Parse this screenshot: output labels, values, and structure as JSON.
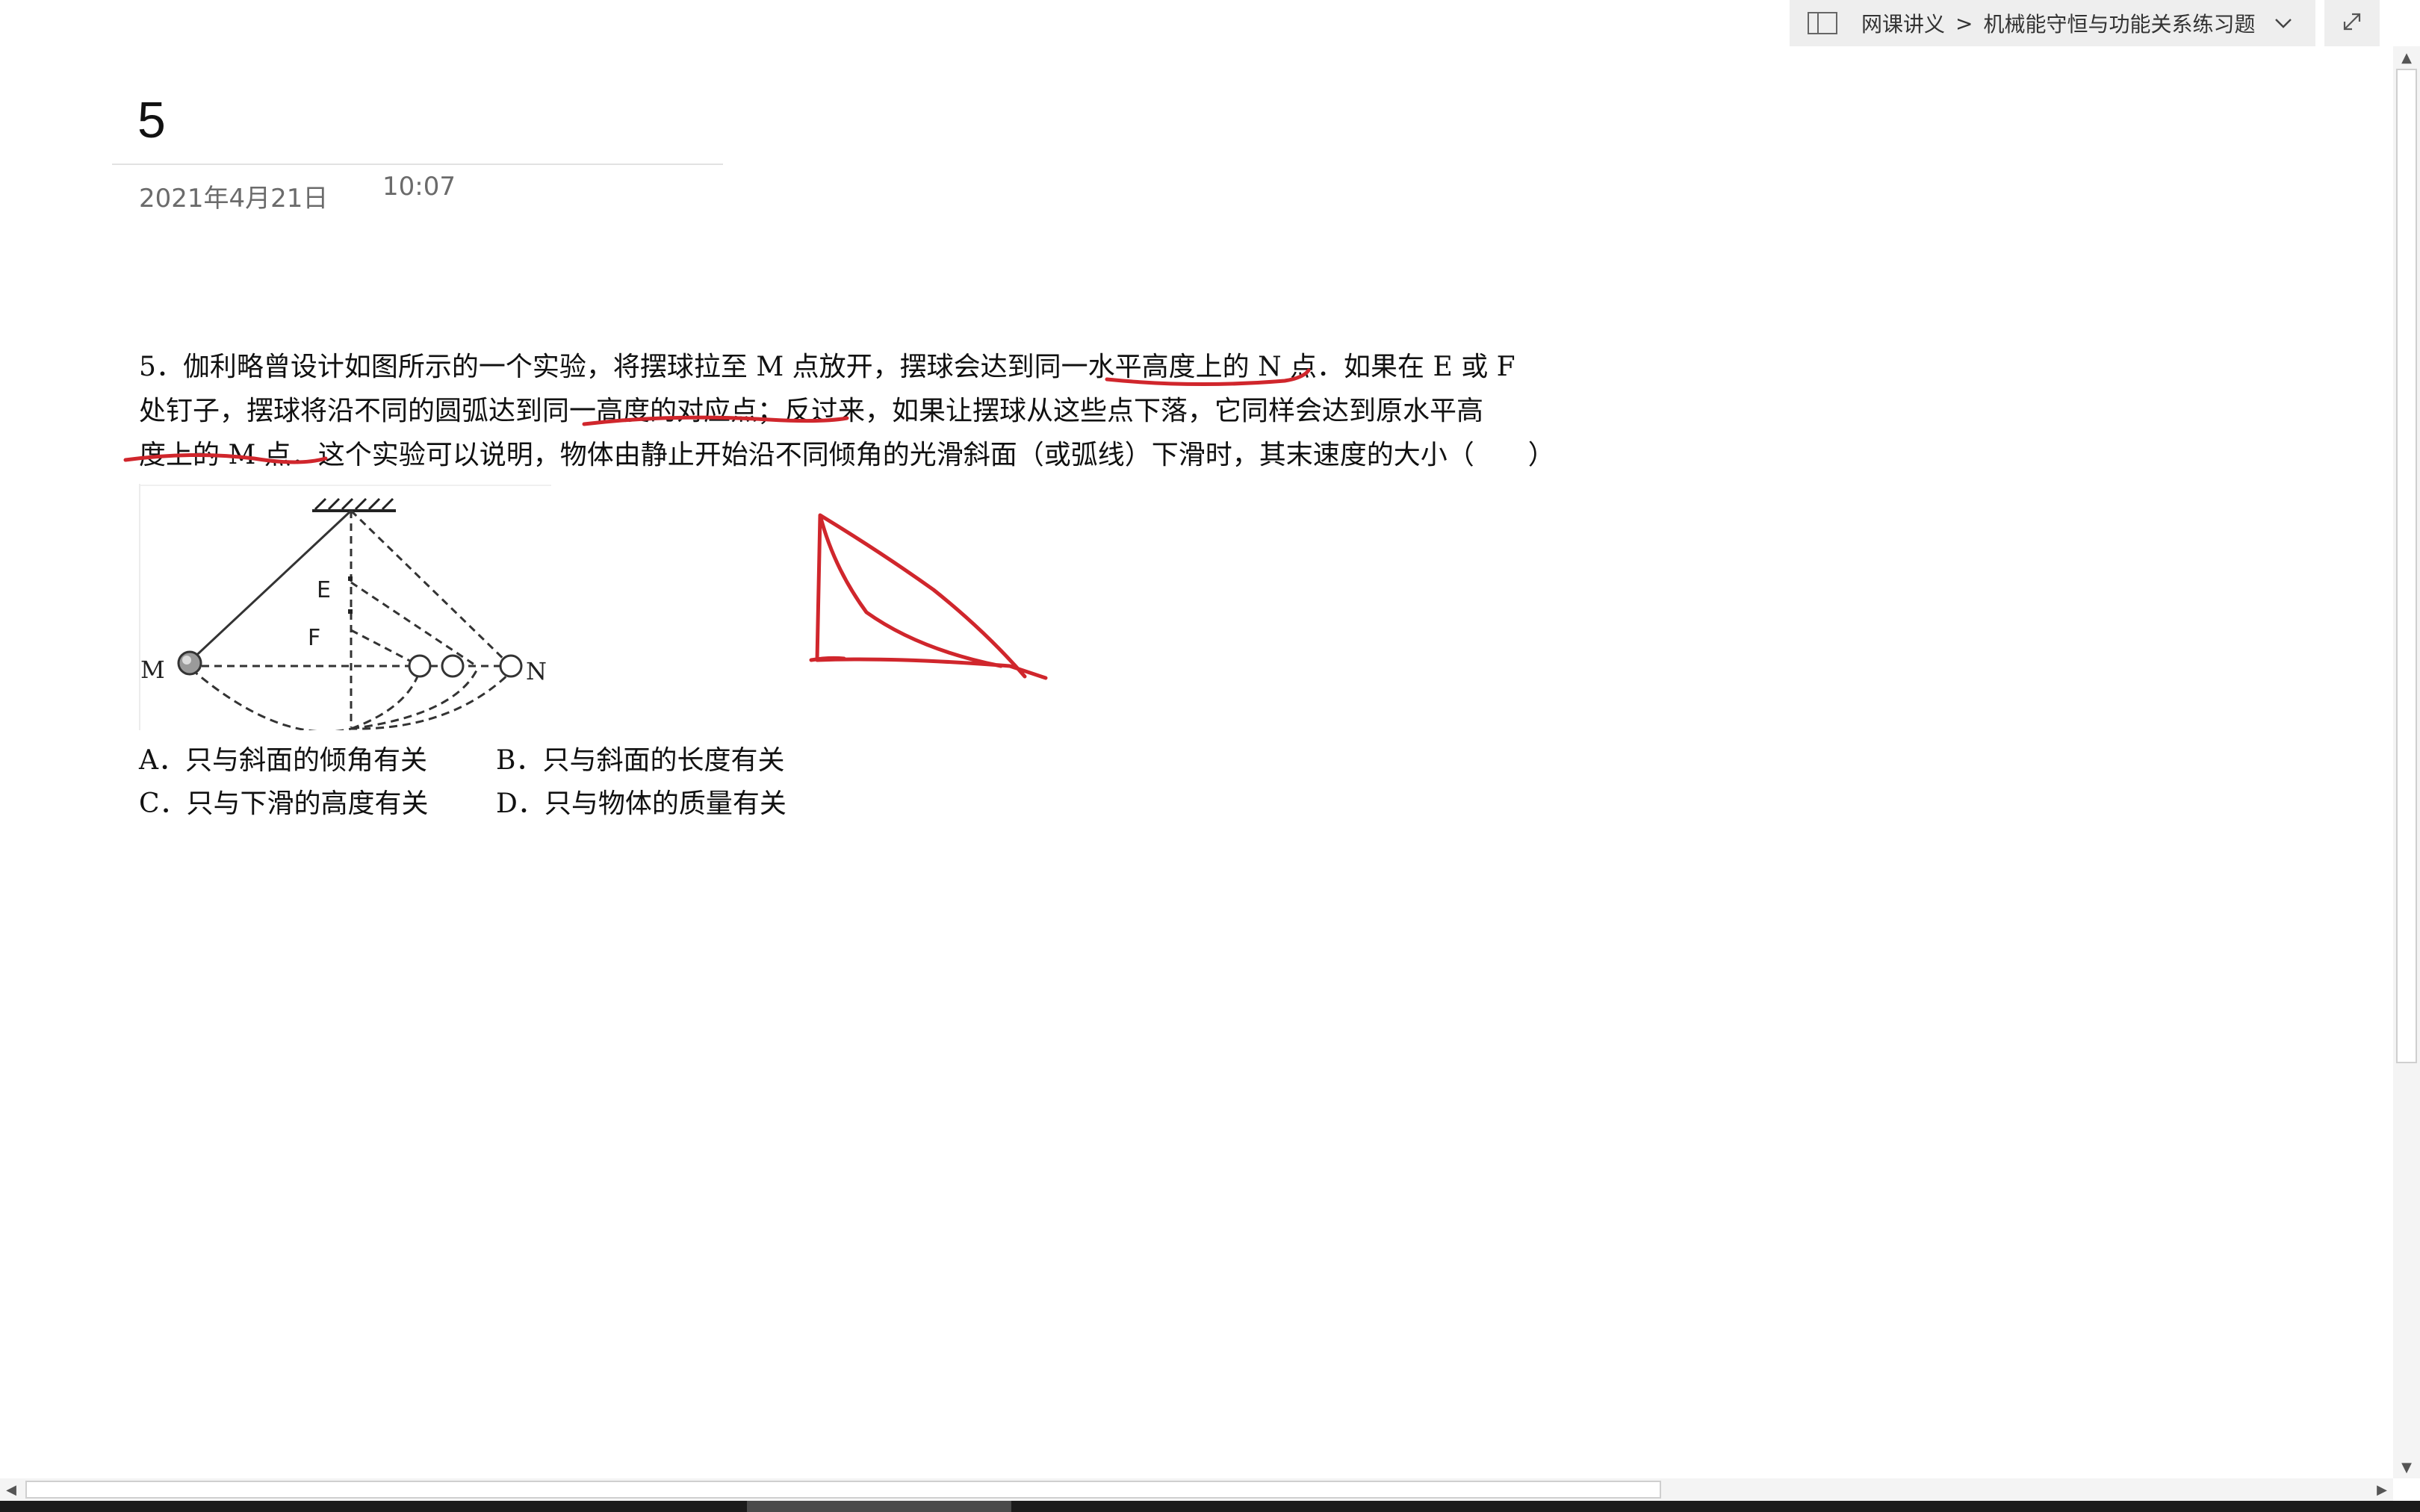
{
  "breadcrumb": {
    "notebook": "网课讲义",
    "separator": ">",
    "section": "机械能守恒与功能关系练习题"
  },
  "page": {
    "title": "5",
    "date": "2021年4月21日",
    "time": "10:07"
  },
  "question": {
    "line1": "5．伽利略曾设计如图所示的一个实验，将摆球拉至 M 点放开，摆球会达到同一水平高度上的 N 点．如果在 E 或 F",
    "line2": "处钉子，摆球将沿不同的圆弧达到同一高度的对应点；反过来，如果让摆球从这些点下落，它同样会达到原水平高",
    "line3": "度上的 M 点．这个实验可以说明，物体由静止开始沿不同倾角的光滑斜面（或弧线）下滑时，其末速度的大小（　　）"
  },
  "figure": {
    "label_m": "M",
    "label_n": "N",
    "label_e": "E",
    "label_f": "F"
  },
  "options": {
    "a": "A．只与斜面的倾角有关",
    "b": "B．只与斜面的长度有关",
    "c": "C．只与下滑的高度有关",
    "d": "D．只与物体的质量有关"
  },
  "ink_color": "#d0262c"
}
